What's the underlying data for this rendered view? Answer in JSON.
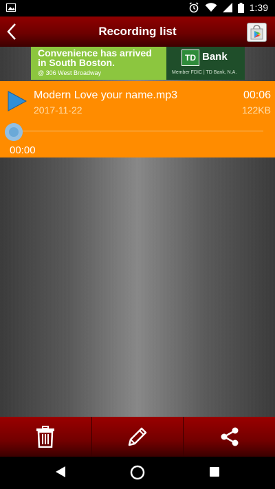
{
  "status_bar": {
    "time": "1:39"
  },
  "app_bar": {
    "title": "Recording list"
  },
  "ad": {
    "line1": "Convenience has arrived",
    "line2": "in South Boston.",
    "address": "@ 306 West Broadway",
    "brand_badge": "TD",
    "brand": "Bank",
    "member": "Member FDIC | TD Bank, N.A."
  },
  "recordings": [
    {
      "name": "Modern Love your name.mp3",
      "duration": "00:06",
      "date": "2017-11-22",
      "size": "122KB",
      "position": "00:00",
      "progress": 0
    }
  ],
  "toolbar": {
    "delete_icon": "trash-icon",
    "edit_icon": "pencil-icon",
    "share_icon": "share-icon"
  },
  "colors": {
    "accent": "#8f0000",
    "selected_row": "#ff8c00",
    "play_icon": "#2f8fd8"
  }
}
